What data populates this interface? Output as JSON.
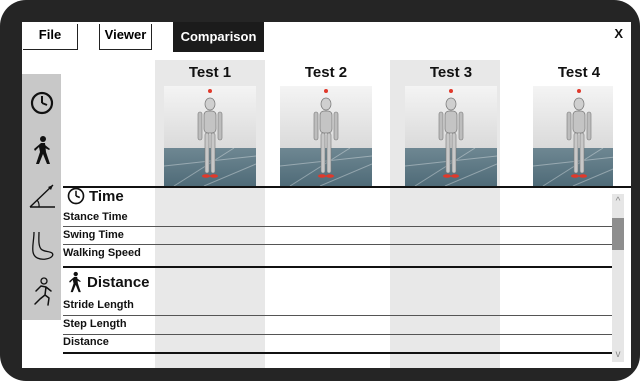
{
  "tabs": {
    "file": "File",
    "viewer": "Viewer",
    "comparison": "Comparison"
  },
  "close_label": "X",
  "sidebar": {
    "icons": [
      "clock-icon",
      "walking-person-icon",
      "angle-icon",
      "foot-icon",
      "running-person-icon"
    ]
  },
  "columns": [
    "Test 1",
    "Test 2",
    "Test 3",
    "Test 4"
  ],
  "sections": {
    "time": {
      "title": "Time",
      "rows": [
        "Stance Time",
        "Swing Time",
        "Walking Speed"
      ]
    },
    "distance": {
      "title": "Distance",
      "rows": [
        "Stride Length",
        "Step Length",
        "Distance"
      ]
    }
  },
  "scrollbar": {
    "up": "^",
    "down": "v"
  },
  "colors": {
    "bezel": "#252525",
    "active_tab": "#1b1b1b",
    "sidebar": "#c8c8c8",
    "column_shade": "#e8e8e8",
    "marker": "#e0392b"
  }
}
